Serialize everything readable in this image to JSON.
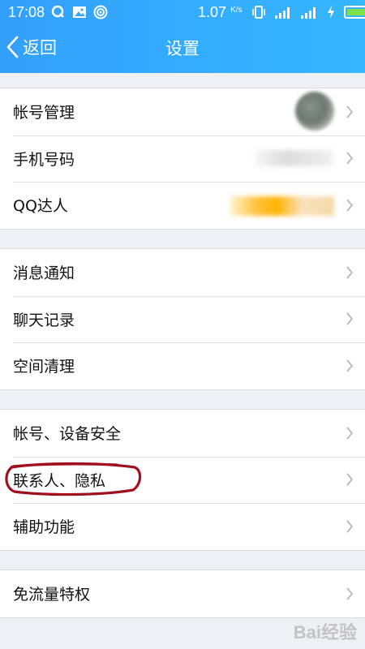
{
  "status_bar": {
    "time": "17:08",
    "speed_value": "1.07",
    "speed_unit": "K/s",
    "battery_level": 0.95,
    "left_icons": [
      "qq-notification-icon",
      "image-notification-icon",
      "hotspot-icon"
    ],
    "right_icons": [
      "vibrate-icon",
      "4g-signal-icon",
      "signal-icon",
      "charging-icon",
      "battery-icon"
    ]
  },
  "nav": {
    "back_label": "返回",
    "title": "设置"
  },
  "groups": [
    {
      "items": [
        {
          "label": "帐号管理"
        },
        {
          "label": "手机号码"
        },
        {
          "label": "QQ达人"
        }
      ]
    },
    {
      "items": [
        {
          "label": "消息通知"
        },
        {
          "label": "聊天记录"
        },
        {
          "label": "空间清理"
        }
      ]
    },
    {
      "items": [
        {
          "label": "帐号、设备安全"
        },
        {
          "label": "联系人、隐私"
        },
        {
          "label": "辅助功能"
        }
      ]
    },
    {
      "items": [
        {
          "label": "免流量特权"
        }
      ]
    }
  ],
  "colors": {
    "header_start": "#33a0fb",
    "header_end": "#35b6ff",
    "annotation": "#a0101c",
    "background": "#eef0f4"
  },
  "watermark": "Bai经验"
}
